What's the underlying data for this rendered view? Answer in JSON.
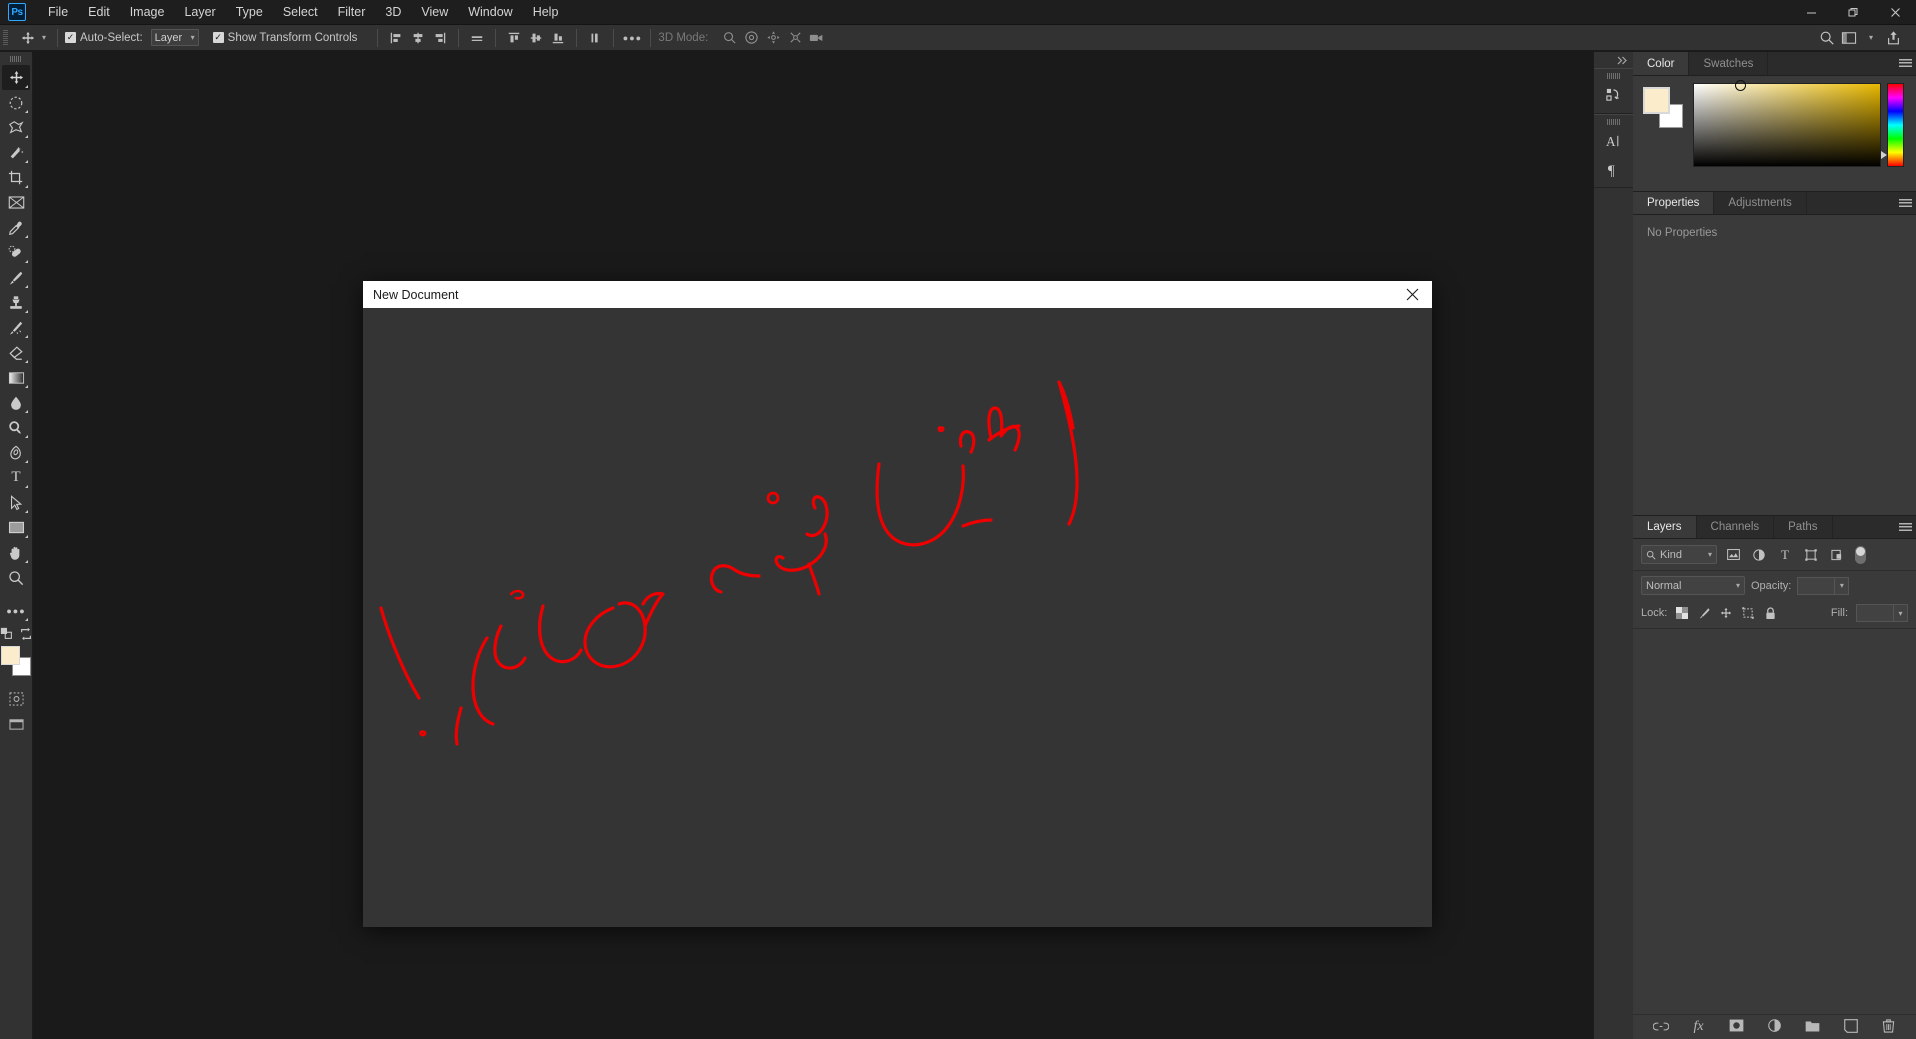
{
  "app": {
    "logo": "Ps",
    "menus": [
      "File",
      "Edit",
      "Image",
      "Layer",
      "Type",
      "Select",
      "Filter",
      "3D",
      "View",
      "Window",
      "Help"
    ],
    "window_controls": {
      "minimize": "—",
      "maximize": "❐",
      "close": "✕"
    }
  },
  "options_bar": {
    "tool_icon": "move-tool",
    "auto_select_checked": "✓",
    "auto_select_label": "Auto-Select:",
    "auto_select_value": "Layer",
    "show_transform_checked": "✓",
    "show_transform_label": "Show Transform Controls",
    "more_label": "●●●",
    "mode_3d_label": "3D Mode:",
    "align_icons": [
      "align-left-edges",
      "align-horizontal-centers",
      "align-right-edges",
      "align-top-edges",
      "align-vertical-centers",
      "align-bottom-edges",
      "distribute-horizontal"
    ],
    "mode_3d_icons": [
      "orbit-3d",
      "roll-3d",
      "pan-3d",
      "slide-3d",
      "camera-3d"
    ],
    "right_icons": [
      "search-icon",
      "workspace-icon",
      "chevron-down-icon",
      "share-icon"
    ]
  },
  "toolbar": {
    "tools": [
      {
        "name": "move-tool",
        "glyph": "✥",
        "active": true,
        "corner": true
      },
      {
        "name": "elliptical-marquee-tool",
        "glyph": "◌",
        "active": false,
        "corner": true
      },
      {
        "name": "lasso-tool",
        "glyph": "⬠",
        "active": false,
        "corner": true
      },
      {
        "name": "magic-wand-tool",
        "glyph": "✦",
        "active": false,
        "corner": true
      },
      {
        "name": "crop-tool",
        "glyph": "⌧",
        "active": false,
        "corner": true
      },
      {
        "name": "frame-tool",
        "glyph": "⌧",
        "active": false,
        "corner": false
      },
      {
        "name": "eyedropper-tool",
        "glyph": "✐",
        "active": false,
        "corner": true
      },
      {
        "name": "spot-healing-brush-tool",
        "glyph": "✎",
        "active": false,
        "corner": true
      },
      {
        "name": "brush-tool",
        "glyph": "✒",
        "active": false,
        "corner": true
      },
      {
        "name": "clone-stamp-tool",
        "glyph": "♟",
        "active": false,
        "corner": true
      },
      {
        "name": "history-brush-tool",
        "glyph": "✐",
        "active": false,
        "corner": true
      },
      {
        "name": "eraser-tool",
        "glyph": "▱",
        "active": false,
        "corner": true
      },
      {
        "name": "gradient-tool",
        "glyph": "▤",
        "active": false,
        "corner": true
      },
      {
        "name": "blur-tool",
        "glyph": "◡",
        "active": false,
        "corner": true
      },
      {
        "name": "dodge-tool",
        "glyph": "⚲",
        "active": false,
        "corner": true
      },
      {
        "name": "pen-tool",
        "glyph": "✒",
        "active": false,
        "corner": true
      },
      {
        "name": "type-tool",
        "glyph": "T",
        "active": false,
        "corner": true
      },
      {
        "name": "path-selection-tool",
        "glyph": "➤",
        "active": false,
        "corner": true
      },
      {
        "name": "rectangle-tool",
        "glyph": "▭",
        "active": false,
        "corner": true
      },
      {
        "name": "hand-tool",
        "glyph": "✋",
        "active": false,
        "corner": true
      },
      {
        "name": "zoom-tool",
        "glyph": "⌕",
        "active": false,
        "corner": false
      }
    ],
    "edit_toolbar_glyph": "●●●",
    "foreground_color": "#fbeccb",
    "background_color": "#ffffff",
    "quickmask_glyph": "▢"
  },
  "dock_strip": {
    "collapse_glyph": "»",
    "groups": [
      {
        "icons": [
          {
            "name": "history-icon",
            "glyph": "↺"
          }
        ]
      },
      {
        "icons": [
          {
            "name": "character-icon",
            "glyph": "A"
          },
          {
            "name": "paragraph-icon",
            "glyph": "¶"
          }
        ]
      }
    ]
  },
  "color_panel": {
    "tabs": [
      {
        "label": "Color",
        "active": true
      },
      {
        "label": "Swatches",
        "active": false
      }
    ],
    "foreground_color": "#fbeccb",
    "background_color": "#ffffff",
    "field_hue_color": "#e8b800",
    "menu_icon": "panel-menu-icon"
  },
  "properties_panel": {
    "tabs": [
      {
        "label": "Properties",
        "active": true
      },
      {
        "label": "Adjustments",
        "active": false
      }
    ],
    "empty_message": "No Properties",
    "menu_icon": "panel-menu-icon"
  },
  "layers_panel": {
    "tabs": [
      {
        "label": "Layers",
        "active": true
      },
      {
        "label": "Channels",
        "active": false
      },
      {
        "label": "Paths",
        "active": false
      }
    ],
    "menu_icon": "panel-menu-icon",
    "filter": {
      "search_icon": "search-icon",
      "kind_label": "Kind",
      "type_filters": [
        {
          "name": "filter-pixel-icon",
          "glyph": "▣"
        },
        {
          "name": "filter-adjustment-icon",
          "glyph": "◑"
        },
        {
          "name": "filter-type-icon",
          "glyph": "T"
        },
        {
          "name": "filter-shape-icon",
          "glyph": "⬚"
        },
        {
          "name": "filter-smartobject-icon",
          "glyph": "❐"
        }
      ],
      "toggle_name": "filter-enable-toggle"
    },
    "blend_mode": "Normal",
    "opacity_label": "Opacity:",
    "opacity_value": "",
    "lock_label": "Lock:",
    "fill_label": "Fill:",
    "fill_value": "",
    "lock_icons": [
      {
        "name": "lock-transparent-pixels-icon",
        "glyph": "▒"
      },
      {
        "name": "lock-image-pixels-icon",
        "glyph": "✒"
      },
      {
        "name": "lock-position-icon",
        "glyph": "✥"
      },
      {
        "name": "lock-artboard-nesting-icon",
        "glyph": "⬚"
      },
      {
        "name": "lock-all-icon",
        "glyph": "🔒"
      }
    ],
    "footer_icons": [
      {
        "name": "link-layers-icon",
        "glyph": "⚭"
      },
      {
        "name": "layer-style-icon",
        "glyph": "fx"
      },
      {
        "name": "layer-mask-icon",
        "glyph": "▣"
      },
      {
        "name": "adjustment-layer-icon",
        "glyph": "◑"
      },
      {
        "name": "new-group-icon",
        "glyph": "🗀"
      },
      {
        "name": "new-layer-icon",
        "glyph": "❐"
      },
      {
        "name": "delete-layer-icon",
        "glyph": "🗑"
      }
    ]
  },
  "dialog": {
    "title": "New Document",
    "close_glyph": "✕",
    "annotation": {
      "description": "Red handwritten Persian/Arabic annotation scrawled across the dialog body",
      "color": "#ee0000",
      "stroke_width": 3.2
    }
  }
}
